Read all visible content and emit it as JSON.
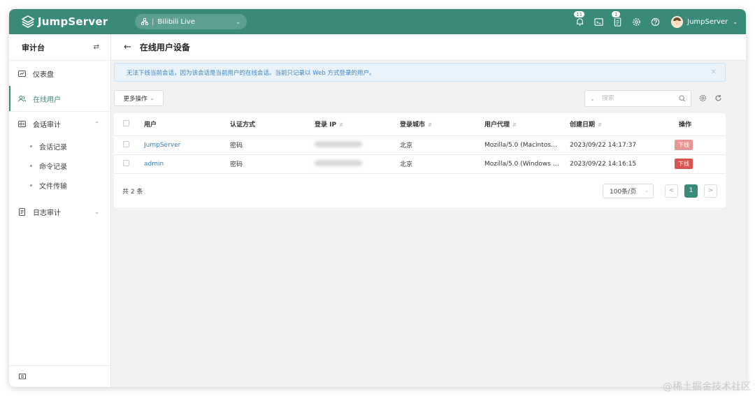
{
  "app": {
    "name": "JumpServer",
    "org": "Bilibili Live",
    "notifications_count": "11",
    "tickets_count": "1",
    "user": "JumpServer"
  },
  "sidebar": {
    "title": "审计台",
    "items": [
      {
        "label": "仪表盘"
      },
      {
        "label": "在线用户"
      },
      {
        "label": "会话审计"
      },
      {
        "label": "日志审计"
      }
    ],
    "session_sub": [
      {
        "label": "会话记录"
      },
      {
        "label": "命令记录"
      },
      {
        "label": "文件传输"
      }
    ]
  },
  "page": {
    "title": "在线用户设备",
    "alert": "无法下线当前会话，因为该会话是当前用户的在线会话。当前只记录以 Web 方式登录的用户。",
    "more_actions": "更多操作",
    "search_placeholder": "搜索"
  },
  "table": {
    "headers": [
      "用户",
      "认证方式",
      "登录 IP",
      "登录城市",
      "用户代理",
      "创建日期",
      "操作"
    ],
    "rows": [
      {
        "user": "JumpServer",
        "auth": "密码",
        "city": "北京",
        "agent": "Mozilla/5.0 (Macintos…",
        "created": "2023/09/22 14:17:37",
        "action": "下线"
      },
      {
        "user": "admin",
        "auth": "密码",
        "city": "北京",
        "agent": "Mozilla/5.0 (Windows …",
        "created": "2023/09/22 14:16:15",
        "action": "下线"
      }
    ],
    "total": "共 2 条",
    "page_size": "100条/页",
    "current_page": "1",
    "prev": "<",
    "next": ">"
  },
  "watermark": "@稀土掘金技术社区",
  "colors": {
    "brand": "#3a8a79",
    "danger": "#d9534f",
    "info": "#3f84c2"
  }
}
